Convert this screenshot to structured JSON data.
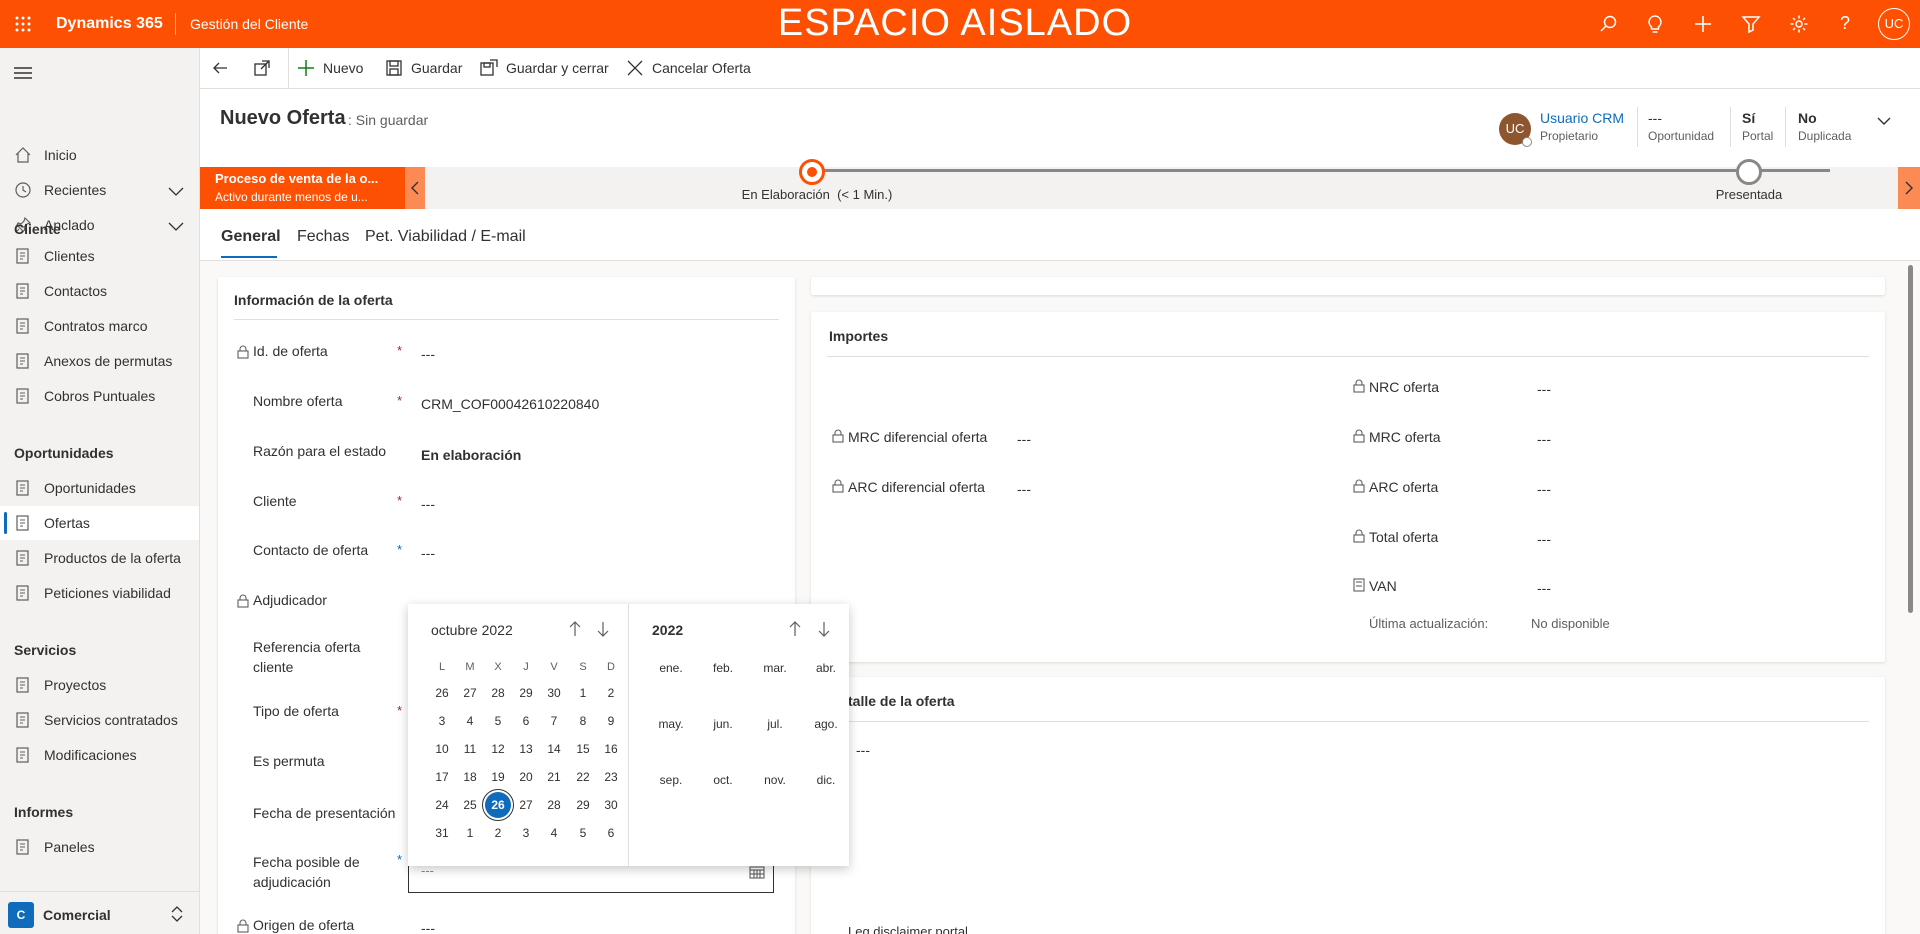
{
  "topbar": {
    "app": "Dynamics 365",
    "area": "Gestión del Cliente",
    "env": "ESPACIO AISLADO",
    "avatar": "UC"
  },
  "sidebar": {
    "nav": [
      {
        "label": "Inicio",
        "icon": "home-icon"
      },
      {
        "label": "Recientes",
        "icon": "clock-icon"
      },
      {
        "label": "Anclado",
        "icon": "pin-icon"
      }
    ],
    "groups": [
      {
        "title": "Cliente",
        "items": [
          "Clientes",
          "Contactos",
          "Contratos marco",
          "Anexos de permutas",
          "Cobros Puntuales"
        ]
      },
      {
        "title": "Oportunidades",
        "items": [
          "Oportunidades",
          "Ofertas",
          "Productos de la oferta",
          "Peticiones viabilidad"
        ]
      },
      {
        "title": "Servicios",
        "items": [
          "Proyectos",
          "Servicios contratados",
          "Modificaciones"
        ]
      },
      {
        "title": "Informes",
        "items": [
          "Paneles"
        ]
      }
    ],
    "selected": "Ofertas",
    "area_switcher": {
      "badge": "C",
      "label": "Comercial"
    }
  },
  "commands": {
    "nuevo": "Nuevo",
    "guardar": "Guardar",
    "guardar_cerrar": "Guardar y cerrar",
    "cancelar": "Cancelar Oferta"
  },
  "header": {
    "title": "Nuevo Oferta",
    "subtitle": ": Sin guardar",
    "owner_initials": "UC",
    "owner_name": "Usuario CRM",
    "owner_label": "Propietario",
    "f1_value": "---",
    "f1_label": "Oportunidad",
    "f2_value": "Sí",
    "f2_label": "Portal",
    "f3_value": "No",
    "f3_label": "Duplicada"
  },
  "bpf": {
    "title": "Proceso de venta de la o...",
    "sub": "Activo durante menos de u...",
    "stage1": "En Elaboración  (< 1 Min.)",
    "stage2": "Presentada"
  },
  "tabs": [
    "General",
    "Fechas",
    "Pet. Viabilidad / E-mail"
  ],
  "info": {
    "section": "Información de la oferta",
    "fields": [
      {
        "label": "Id. de oferta",
        "value": "---"
      },
      {
        "label": "Nombre oferta",
        "value": "CRM_COF00042610220840"
      },
      {
        "label": "Razón para el estado",
        "value": "En elaboración"
      },
      {
        "label": "Cliente",
        "value": "---"
      },
      {
        "label": "Contacto de oferta",
        "value": "---"
      },
      {
        "label": "Adjudicador",
        "value": ""
      },
      {
        "label": "Referencia oferta cliente",
        "value": ""
      },
      {
        "label": "Tipo de oferta",
        "value": ""
      },
      {
        "label": "Es permuta",
        "value": ""
      },
      {
        "label": "Fecha de presentación",
        "value": ""
      },
      {
        "label": "Fecha posible de adjudicación",
        "value": "---"
      },
      {
        "label": "Origen de oferta",
        "value": "---"
      }
    ]
  },
  "importes": {
    "section": "Importes",
    "right": [
      {
        "label": "NRC oferta",
        "value": "---"
      },
      {
        "label": "MRC oferta",
        "value": "---"
      },
      {
        "label": "ARC oferta",
        "value": "---"
      },
      {
        "label": "Total oferta",
        "value": "---"
      },
      {
        "label": "VAN",
        "value": "---"
      }
    ],
    "left": [
      {
        "label": "MRC diferencial oferta",
        "value": "---"
      },
      {
        "label": "ARC diferencial oferta",
        "value": "---"
      }
    ],
    "updated_label": "Última actualización:",
    "updated_value": "No disponible"
  },
  "detalle": {
    "section": "talle de la oferta",
    "value": "---",
    "footer": "Leg disclaimer portal"
  },
  "calendar": {
    "month_title": "octubre 2022",
    "year_title": "2022",
    "weekdays": [
      "L",
      "M",
      "X",
      "J",
      "V",
      "S",
      "D"
    ],
    "weeks": [
      [
        "26",
        "27",
        "28",
        "29",
        "30",
        "1",
        "2"
      ],
      [
        "3",
        "4",
        "5",
        "6",
        "7",
        "8",
        "9"
      ],
      [
        "10",
        "11",
        "12",
        "13",
        "14",
        "15",
        "16"
      ],
      [
        "17",
        "18",
        "19",
        "20",
        "21",
        "22",
        "23"
      ],
      [
        "24",
        "25",
        "26",
        "27",
        "28",
        "29",
        "30"
      ],
      [
        "31",
        "1",
        "2",
        "3",
        "4",
        "5",
        "6"
      ]
    ],
    "selected": "26",
    "months": [
      "ene.",
      "feb.",
      "mar.",
      "abr.",
      "may.",
      "jun.",
      "jul.",
      "ago.",
      "sep.",
      "oct.",
      "nov.",
      "dic."
    ]
  },
  "colors": {
    "brand": "#fe5002",
    "accent": "#0f6cbd",
    "required": "#a4262c"
  }
}
